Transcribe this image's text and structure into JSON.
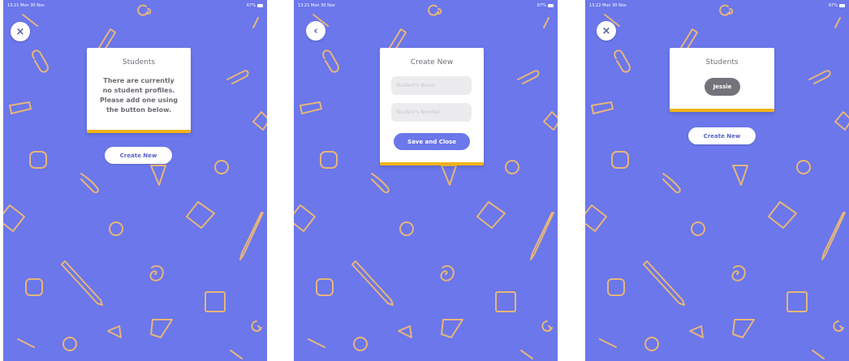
{
  "screens": [
    {
      "status": {
        "time": "13:21  Mon 30 Nov",
        "battery": "67%"
      },
      "nav_icon": "×",
      "card": {
        "title": "Students",
        "message": "There are currently no student profiles. Please add one using the button below."
      },
      "create_button": "Create New"
    },
    {
      "status": {
        "time": "13:21  Mon 30 Nov",
        "battery": "67%"
      },
      "nav_icon": "‹",
      "card": {
        "title": "Create New",
        "name_placeholder": "Student's Name",
        "number_placeholder": "Student's Number",
        "save_button": "Save and Close"
      }
    },
    {
      "status": {
        "time": "13:22  Mon 30 Nov",
        "battery": "67%"
      },
      "nav_icon": "×",
      "card": {
        "title": "Students",
        "student": "Jessie"
      },
      "create_button": "Create New"
    }
  ],
  "colors": {
    "background": "#6b77ea",
    "doodle": "#e7b57a",
    "card_accent": "#f2b318",
    "student_pill": "#74737b"
  }
}
